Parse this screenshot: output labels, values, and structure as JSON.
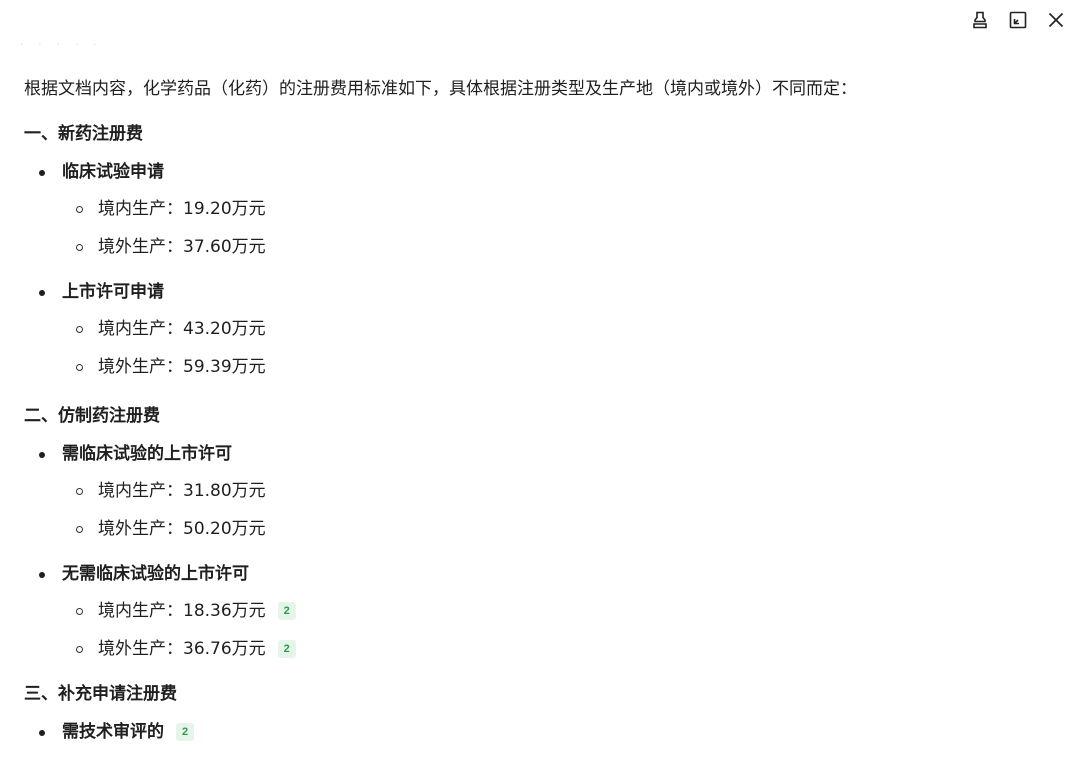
{
  "toolbar": {
    "icons": [
      "pin-icon",
      "expand-icon",
      "close-icon"
    ]
  },
  "faint_header": "· · · · ·",
  "intro": "根据文档内容，化学药品（化药）的注册费用标准如下，具体根据注册类型及生产地（境内或境外）不同而定：",
  "sections": [
    {
      "title": "一、新药注册费",
      "items": [
        {
          "label": "临床试验申请",
          "subitems": [
            {
              "text": "境内生产：19.20万元"
            },
            {
              "text": "境外生产：37.60万元"
            }
          ]
        },
        {
          "label": "上市许可申请",
          "subitems": [
            {
              "text": "境内生产：43.20万元"
            },
            {
              "text": "境外生产：59.39万元"
            }
          ]
        }
      ]
    },
    {
      "title": "二、仿制药注册费",
      "items": [
        {
          "label": "需临床试验的上市许可",
          "subitems": [
            {
              "text": "境内生产：31.80万元"
            },
            {
              "text": "境外生产：50.20万元"
            }
          ]
        },
        {
          "label": "无需临床试验的上市许可",
          "subitems": [
            {
              "text": "境内生产：18.36万元",
              "badge": "2"
            },
            {
              "text": "境外生产：36.76万元",
              "badge": "2"
            }
          ]
        }
      ]
    },
    {
      "title": "三、补充申请注册费",
      "items": [
        {
          "label": "需技术审评的",
          "badge": "2",
          "subitems": []
        }
      ]
    }
  ],
  "colors": {
    "text": "#1f1f1f",
    "badge_bg": "#e6f5ea",
    "badge_text": "#2e9a4f"
  }
}
